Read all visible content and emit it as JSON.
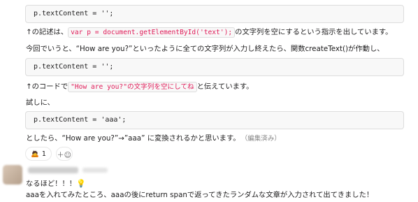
{
  "message1": {
    "code1": "p.textContent = '';",
    "line1_prefix": "↑の記述は、",
    "line1_code": "var p = document.getElementById('text');",
    "line1_suffix": "の文字列を空にするという指示を出しています。",
    "line2": "今回でいうと、“How are you?”といったように全ての文字列が入力し終えたら、関数createText()が作動し、",
    "code2": "p.textContent = '';",
    "line3_prefix": "↑のコードで",
    "line3_code": "\"How are you?\"の文字列を空にしてね",
    "line3_suffix": "と伝えています。",
    "line4": "試しに、",
    "code3": "p.textContent = 'aaa';",
    "line5": "としたら、“How are you?”→”aaa” に変換されるかと思います。",
    "edited_label": "（編集済み）",
    "reactions": [
      {
        "emoji": "🙇",
        "count": "1"
      }
    ],
    "add_reaction_icon": "＋☺"
  },
  "message2": {
    "line1_text": "なるほど！！！",
    "line1_emoji": "💡",
    "line2": "aaaを入れてみたところ、aaaの後にreturn spanで返ってきたランダムな文章が入力されて出てきました！"
  }
}
